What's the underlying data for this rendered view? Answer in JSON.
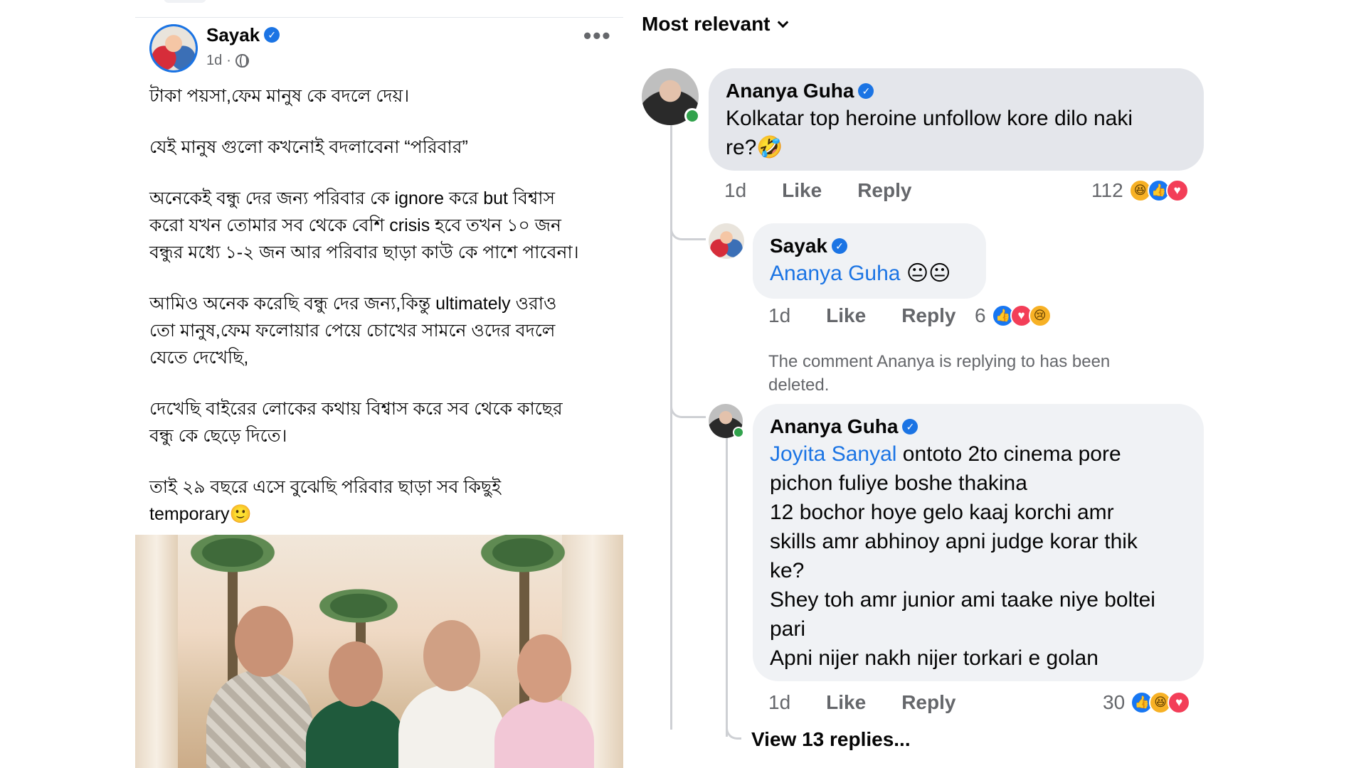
{
  "post": {
    "author": "Sayak",
    "time": "1d",
    "paragraphs": [
      "টাকা পয়সা,ফেম মানুষ কে বদলে দেয়।",
      "যেই মানুষ গুলো কখনোই বদলাবেনা “পরিবার”",
      "অনেকেই বন্ধু দের জন্য পরিবার কে ignore করে but বিশ্বাস\nকরো যখন তোমার সব থেকে বেশি crisis হবে তখন ১০ জন\nবন্ধুর মধ্যে ১-২ জন আর পরিবার ছাড়া কাউ কে পাশে পাবেনা।",
      "আমিও অনেক করেছি বন্ধু দের জন্য,কিন্তু ultimately ওরাও\nতো মানুষ,ফেম ফলোয়ার পেয়ে চোখের সামনে ওদের বদলে\nযেতে দেখেছি,",
      "দেখেছি বাইরের লোকের কথায় বিশ্বাস করে সব থেকে কাছের\nবন্ধু কে ছেড়ে দিতে।",
      "তাই ২৯ বছরে এসে বুঝেছি পরিবার ছাড়া সব কিছুই\ntemporary🙂"
    ]
  },
  "comments_panel": {
    "sort_label": "Most relevant",
    "comments": [
      {
        "author": "Ananya Guha",
        "text": "Kolkatar top heroine unfollow kore dilo naki\nre?🤣",
        "time": "1d",
        "like_label": "Like",
        "reply_label": "Reply",
        "reaction_count": "112",
        "reactions": [
          "haha-icon",
          "like-icon",
          "love-icon"
        ]
      },
      {
        "author": "Sayak",
        "mention": "Ananya Guha",
        "text": " 😐😐",
        "time": "1d",
        "like_label": "Like",
        "reply_label": "Reply",
        "reaction_count": "6",
        "reactions": [
          "like-icon",
          "love-icon",
          "sad-icon"
        ]
      },
      {
        "deleted_note": "The comment Ananya is replying to has been\ndeleted."
      },
      {
        "author": "Ananya Guha",
        "mention": "Joyita Sanyal",
        "text_first": " ontoto 2to cinema pore",
        "text_rest": "pichon fuliye boshe thakina\n12 bochor hoye gelo kaaj korchi amr\nskills amr abhinoy apni judge korar thik\nke?\nShey toh amr junior ami taake niye boltei\npari\nApni nijer nakh nijer torkari e golan",
        "time": "1d",
        "like_label": "Like",
        "reply_label": "Reply",
        "reaction_count": "30",
        "reactions": [
          "like-icon",
          "haha-icon",
          "love-icon"
        ]
      }
    ],
    "view_replies": "View 13 replies..."
  }
}
